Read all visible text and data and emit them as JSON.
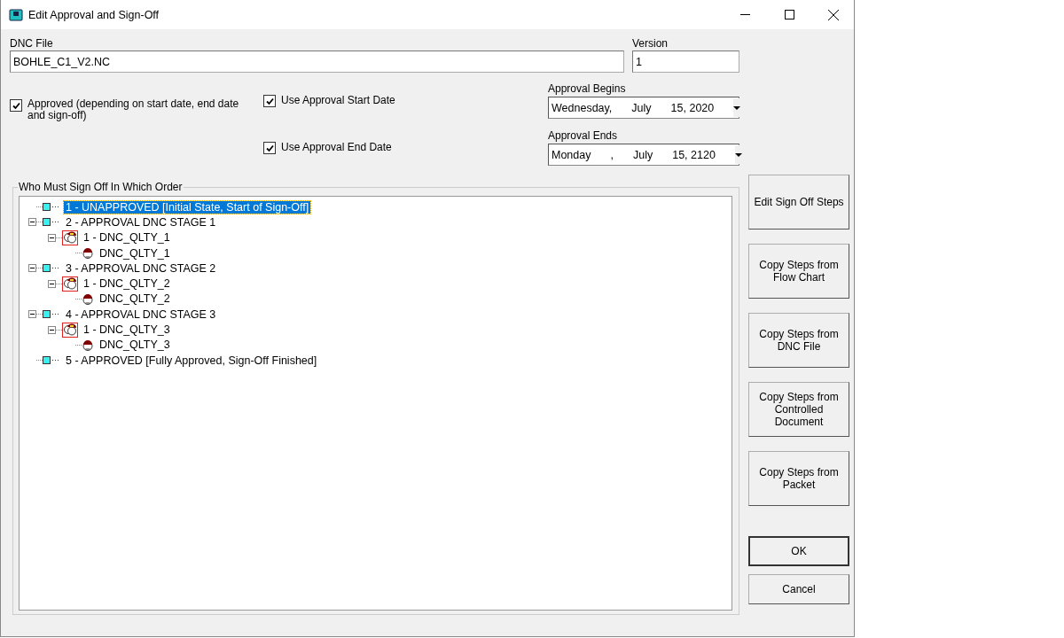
{
  "window": {
    "title": "Edit Approval and Sign-Off"
  },
  "dnc_file": {
    "label": "DNC File",
    "value": "BOHLE_C1_V2.NC"
  },
  "version": {
    "label": "Version",
    "value": "1"
  },
  "options": [
    {
      "label": "Approved (depending on start date, end date and sign-off)",
      "checked": true
    },
    {
      "label": "Use Approval Start Date",
      "checked": true
    },
    {
      "label": "Use Approval End Date",
      "checked": true
    }
  ],
  "approval_begins": {
    "label": "Approval Begins",
    "parts": [
      "Wednesday,",
      "July",
      "15, 2020"
    ]
  },
  "approval_ends": {
    "label": "Approval Ends",
    "parts": [
      "Monday",
      ",",
      "July",
      "15, 2120"
    ]
  },
  "sign_off": {
    "title": "Who Must Sign Off In Which Order",
    "tree": [
      {
        "kind": "stage",
        "label": "1 - UNAPPROVED [Initial State, Start of Sign-Off]",
        "selected": true
      },
      {
        "kind": "stage",
        "label": "2 - APPROVAL DNC STAGE 1",
        "selected": false,
        "expanded": true,
        "children": [
          {
            "kind": "group",
            "label": "1 - DNC_QLTY_1",
            "selected": false,
            "expanded": true,
            "children": [
              {
                "kind": "user",
                "label": "DNC_QLTY_1",
                "selected": false
              }
            ]
          }
        ]
      },
      {
        "kind": "stage",
        "label": "3 - APPROVAL DNC STAGE 2",
        "selected": false,
        "expanded": true,
        "children": [
          {
            "kind": "group",
            "label": "1 - DNC_QLTY_2",
            "selected": false,
            "expanded": true,
            "children": [
              {
                "kind": "user",
                "label": "DNC_QLTY_2",
                "selected": false
              }
            ]
          }
        ]
      },
      {
        "kind": "stage",
        "label": "4 - APPROVAL DNC STAGE 3",
        "selected": false,
        "expanded": true,
        "children": [
          {
            "kind": "group",
            "label": "1 - DNC_QLTY_3",
            "selected": false,
            "expanded": true,
            "children": [
              {
                "kind": "user",
                "label": "DNC_QLTY_3",
                "selected": false
              }
            ]
          }
        ]
      },
      {
        "kind": "stage",
        "label": "5 - APPROVED [Fully Approved, Sign-Off Finished]",
        "selected": false
      }
    ]
  },
  "side_buttons": [
    "Edit Sign Off Steps",
    "Copy Steps from Flow Chart",
    "Copy Steps from DNC File",
    "Copy Steps from Controlled Document",
    "Copy Steps from Packet"
  ],
  "dialog_buttons": [
    "OK",
    "Cancel"
  ]
}
